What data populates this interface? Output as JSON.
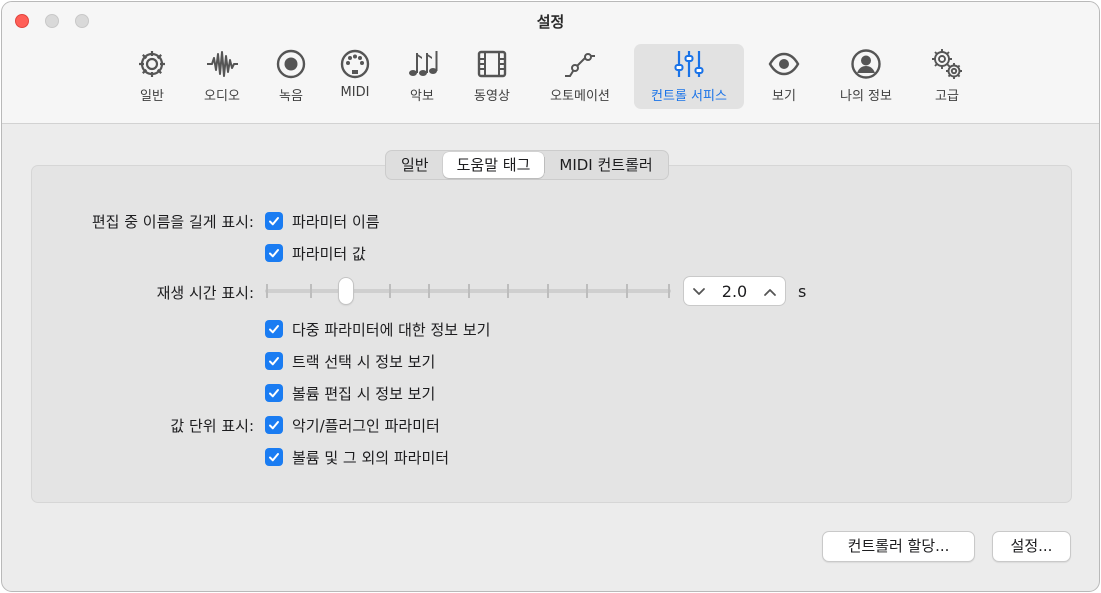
{
  "window": {
    "title": "설정"
  },
  "toolbar": {
    "items": [
      {
        "label": "일반",
        "icon": "gear-icon"
      },
      {
        "label": "오디오",
        "icon": "waveform-icon"
      },
      {
        "label": "녹음",
        "icon": "record-icon"
      },
      {
        "label": "MIDI",
        "icon": "midi-port-icon"
      },
      {
        "label": "악보",
        "icon": "music-notes-icon"
      },
      {
        "label": "동영상",
        "icon": "film-icon"
      },
      {
        "label": "오토메이션",
        "icon": "automation-curve-icon"
      },
      {
        "label": "컨트롤 서피스",
        "icon": "sliders-icon",
        "active": true
      },
      {
        "label": "보기",
        "icon": "eye-icon"
      },
      {
        "label": "나의 정보",
        "icon": "person-icon"
      },
      {
        "label": "고급",
        "icon": "gears-icon"
      }
    ]
  },
  "tabs": {
    "items": [
      "일반",
      "도움말 태그",
      "MIDI 컨트롤러"
    ],
    "selected": "도움말 태그"
  },
  "settings": {
    "long_name_label": "편집 중 이름을 길게 표시:",
    "param_name": "파라미터 이름",
    "param_value": "파라미터 값",
    "duration_label": "재생 시간 표시:",
    "duration_value": "2.0",
    "duration_unit": "s",
    "duration_slider_fraction": 0.2,
    "multi_param": "다중 파라미터에 대한 정보 보기",
    "track_select": "트랙 선택 시 정보 보기",
    "volume_edit": "볼륨 편집 시 정보 보기",
    "value_unit_label": "값 단위 표시:",
    "instrument_plugin": "악기/플러그인 파라미터",
    "volume_other": "볼륨 및 그 외의 파라미터"
  },
  "buttons": {
    "controller_assign": "컨트롤러 할당...",
    "setup": "설정..."
  },
  "colors": {
    "accent": "#1a7cf2",
    "close": "#ff5f57"
  }
}
